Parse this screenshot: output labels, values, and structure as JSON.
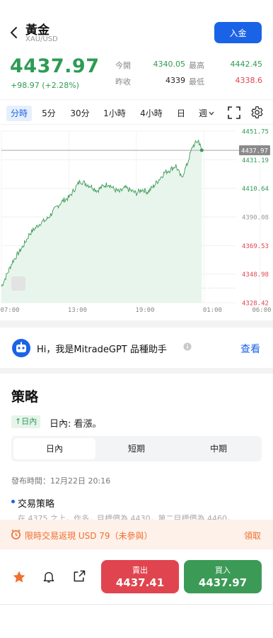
{
  "header": {
    "title": "黃金",
    "symbol": "XAU/USD",
    "deposit_label": "入金"
  },
  "quote": {
    "price": "4437.97",
    "change": "+98.97 (+2.28%)",
    "stats": [
      {
        "label": "今開",
        "value": "4340.05",
        "color": "#2e9b54"
      },
      {
        "label": "最高",
        "value": "4442.45",
        "color": "#2e9b54"
      },
      {
        "label": "昨收",
        "value": "4339",
        "color": "#222222"
      },
      {
        "label": "最低",
        "value": "4338.6",
        "color": "#e0454f"
      }
    ]
  },
  "periods": [
    "分時",
    "5分",
    "30分",
    "1小時",
    "4小時",
    "日",
    "週"
  ],
  "active_period": "分時",
  "chart_data": {
    "type": "area",
    "current_price_label": "4437.97",
    "y_ticks": [
      {
        "value": 4451.75,
        "label": "4451.75",
        "color": "#2e9b54"
      },
      {
        "value": 4431.19,
        "label": "4431.19",
        "color": "#2e9b54"
      },
      {
        "value": 4410.64,
        "label": "4410.64",
        "color": "#2e9b54"
      },
      {
        "value": 4390.08,
        "label": "4390.08",
        "color": "#999999"
      },
      {
        "value": 4369.53,
        "label": "4369.53",
        "color": "#e0454f"
      },
      {
        "value": 4348.98,
        "label": "4348.98",
        "color": "#e0454f"
      },
      {
        "value": 4328.42,
        "label": "4328.42",
        "color": "#e0454f"
      }
    ],
    "x_ticks": [
      "07:00",
      "13:00",
      "19:00",
      "01:00",
      "06:00"
    ],
    "x_tick_hours": [
      0,
      6,
      12,
      18,
      23
    ],
    "ylim": [
      4328.42,
      4451.75
    ],
    "x_range_hours": [
      0,
      23
    ],
    "points_hours": [
      0,
      0.5,
      1,
      1.5,
      2,
      2.5,
      3,
      3.5,
      4,
      4.5,
      5,
      5.5,
      6,
      6.5,
      7,
      7.5,
      8,
      8.5,
      9,
      9.5,
      10,
      10.5,
      11,
      11.5,
      12,
      12.5,
      13,
      13.5,
      14,
      14.5,
      15,
      15.5,
      16,
      16.5,
      17,
      17.5,
      17.8
    ],
    "values": [
      4340,
      4349,
      4358,
      4364,
      4370,
      4378,
      4382,
      4386,
      4388,
      4393,
      4398,
      4402,
      4404,
      4410,
      4416,
      4414,
      4412,
      4409,
      4412,
      4414,
      4410,
      4408,
      4411,
      4409,
      4407,
      4410,
      4408,
      4412,
      4417,
      4422,
      4424,
      4427,
      4418,
      4428,
      4441,
      4445,
      4437.97
    ]
  },
  "gpt": {
    "text": "Hi，我是MitradeGPT 品種助手",
    "link": "查看"
  },
  "strategy": {
    "title": "策略",
    "badge": "↑日內",
    "intraday_text": "日內: 看漲。",
    "tabs": [
      "日內",
      "短期",
      "中期"
    ],
    "active_tab": "日內",
    "published": "發布時間：12月22日 20:16",
    "section_title": "交易策略",
    "faded_text": "在 4375 之上，作多，目標價為 4430，第二目標價為 4460。"
  },
  "promo": {
    "text": "限時交易返現 USD 79（未參與）",
    "claim": "領取"
  },
  "trade": {
    "sell_label": "賣出",
    "sell_price": "4437.41",
    "buy_label": "買入",
    "buy_price": "4437.97"
  },
  "colors": {
    "accent": "#1b63e6",
    "up": "#2e9b54",
    "down": "#e0454f",
    "promo": "#f26e2e"
  }
}
